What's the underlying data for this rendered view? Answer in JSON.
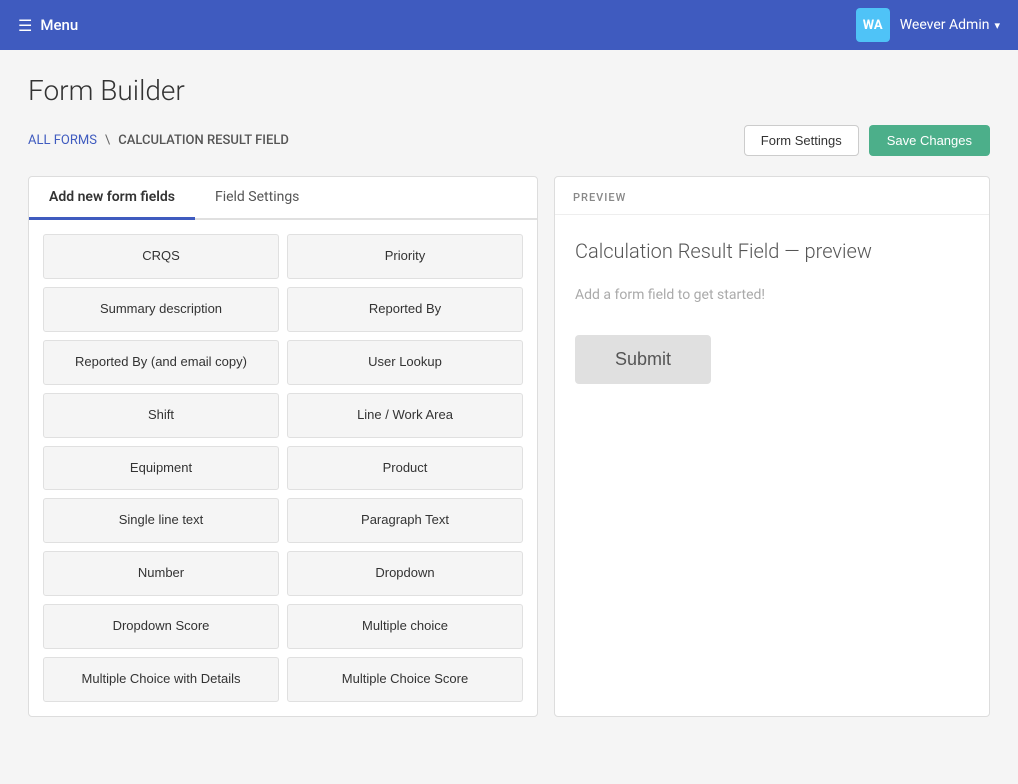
{
  "navbar": {
    "menu_label": "Menu",
    "avatar_initials": "WA",
    "admin_name": "Weever Admin"
  },
  "page": {
    "title": "Form Builder",
    "breadcrumb_link": "ALL FORMS",
    "breadcrumb_sep": "\\",
    "breadcrumb_current": "CALCULATION RESULT FIELD"
  },
  "toolbar": {
    "form_settings_label": "Form Settings",
    "save_changes_label": "Save Changes"
  },
  "left_panel": {
    "tabs": [
      {
        "label": "Add new form fields",
        "active": true
      },
      {
        "label": "Field Settings",
        "active": false
      }
    ],
    "fields_col1": [
      "CRQS",
      "Summary description",
      "Reported By (and email copy)",
      "Shift",
      "Equipment",
      "Single line text",
      "Number",
      "Dropdown Score",
      "Multiple Choice with Details"
    ],
    "fields_col2": [
      "Priority",
      "Reported By",
      "User Lookup",
      "Line / Work Area",
      "Product",
      "Paragraph Text",
      "Dropdown",
      "Multiple choice",
      "Multiple Choice Score"
    ]
  },
  "right_panel": {
    "preview_label": "PREVIEW",
    "preview_title": "Calculation Result Field — preview",
    "preview_empty": "Add a form field to get started!",
    "submit_label": "Submit"
  }
}
